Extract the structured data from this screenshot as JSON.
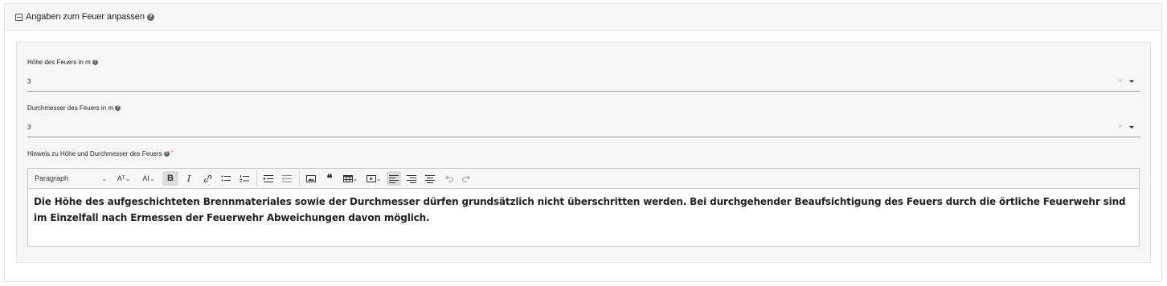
{
  "section": {
    "title": "Angaben zum Feuer anpassen",
    "help_glyph": "?"
  },
  "fields": {
    "height": {
      "label": "Höhe des Feuers in m",
      "value": "3",
      "clear": "×"
    },
    "diameter": {
      "label": "Durchmesser des Feuers in m",
      "value": "3",
      "clear": "×"
    },
    "hint": {
      "label": "Hinweis zu Höhe und Durchmesser des Feuers",
      "required_mark": "*"
    }
  },
  "editor": {
    "toolbar": {
      "paragraph_label": "Paragraph",
      "font_size_glyph": "Aᵀ",
      "font_family_glyph": "AI",
      "bold_glyph": "B",
      "italic_glyph": "I"
    },
    "content": "Die Höhe des aufgeschichteten Brennmateriales sowie der Durchmesser dürfen grundsätzlich nicht überschritten werden. Bei durchgehender Beaufsichtigung des Feuers durch die örtliche Feuerwehr sind im Einzelfall nach Ermessen der Feuerwehr Abweichungen davon möglich."
  },
  "colors": {
    "header_bg": "#f7f7f7",
    "border": "#e3e3e3",
    "required": "#d33333",
    "text": "#222222"
  }
}
